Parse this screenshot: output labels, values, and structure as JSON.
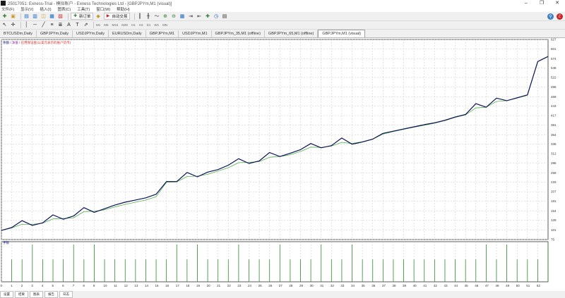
{
  "window": {
    "title": "25017051: Exness-Trial - 模拟账户 - Exness Technologies Ltd - [GBPJPYm,M1 (visual)]",
    "controls": [
      "–",
      "❐",
      "✕"
    ]
  },
  "menu": [
    "文件(F)",
    "显示(V)",
    "插入(I)",
    "图表(C)",
    "工具(T)",
    "窗口(W)",
    "帮助(H)"
  ],
  "toolbar": {
    "new_order_label": "新订单",
    "auto_trading_label": "自动交易",
    "timeframes": [
      "M1",
      "M5",
      "M15",
      "M30",
      "H1",
      "H4",
      "D1",
      "W1",
      "MN"
    ]
  },
  "tabs": [
    {
      "label": "BTCUSDm,Daily",
      "active": false
    },
    {
      "label": "GBPJPYm,Daily",
      "active": false
    },
    {
      "label": "USDJPYm,Daily",
      "active": false
    },
    {
      "label": "EURUSDm,Daily",
      "active": false
    },
    {
      "label": "GBPJPYm,M1",
      "active": false
    },
    {
      "label": "USDJPYm,M1",
      "active": false
    },
    {
      "label": "GBPJPYm_35,M1 (offline)",
      "active": false
    },
    {
      "label": "GBPJPYm_65,M1 (offline)",
      "active": false
    },
    {
      "label": "GBPJPYm,M1 (visual)",
      "active": true
    }
  ],
  "chart_label": {
    "prefix": "余额",
    "middle": " / 净值",
    "suffix": " / 已用保证金(以美元表示的账户货币)"
  },
  "subwindow_label": "手数",
  "bottom_tabs": [
    "设置",
    "结果",
    "图表",
    "报告",
    "日志"
  ],
  "status_text": "",
  "colors": {
    "balance_line": "#0d1257",
    "equity_line": "#55b24f",
    "volume_bars": "#2e8b2e",
    "grid": "#c8c8c8"
  },
  "chart_data": {
    "type": "line",
    "x": [
      0,
      1,
      2,
      3,
      4,
      5,
      6,
      7,
      8,
      9,
      10,
      11,
      12,
      13,
      14,
      15,
      16,
      17,
      18,
      19,
      20,
      21,
      22,
      23,
      24,
      25,
      26,
      27,
      28,
      29,
      30,
      31,
      32,
      33,
      34,
      35,
      36,
      37,
      38,
      39,
      40,
      41,
      42,
      43,
      44,
      45,
      46,
      47,
      48,
      49,
      50,
      51,
      52,
      53
    ],
    "series": [
      {
        "values": [
          100,
          108,
          127,
          114,
          121,
          143,
          131,
          140,
          163,
          150,
          160,
          170,
          178,
          184,
          190,
          200,
          235,
          235,
          260,
          248,
          261,
          268,
          280,
          298,
          285,
          292,
          315,
          304,
          313,
          323,
          340,
          328,
          334,
          355,
          338,
          344,
          352,
          368,
          374,
          380,
          386,
          392,
          397,
          404,
          413,
          420,
          450,
          440,
          465,
          458,
          466,
          474,
          566,
          580
        ]
      },
      {
        "values": [
          100,
          107,
          117,
          117,
          120,
          132,
          133,
          135,
          152,
          153,
          157,
          165,
          172,
          178,
          184,
          193,
          233,
          234,
          249,
          250,
          255,
          264,
          273,
          287,
          288,
          290,
          302,
          304,
          309,
          318,
          330,
          329,
          333,
          343,
          340,
          345,
          352,
          366,
          373,
          379,
          385,
          390,
          396,
          403,
          412,
          419,
          438,
          440,
          456,
          458,
          465,
          473,
          566,
          580
        ]
      }
    ],
    "xlabel": "",
    "ylabel": "",
    "xlim": [
      0,
      53
    ],
    "ylim": [
      75,
      627
    ],
    "y_ticks": [
      75,
      101,
      128,
      154,
      181,
      207,
      233,
      259,
      286,
      312,
      338,
      364,
      391,
      417,
      443,
      469,
      496,
      522,
      548,
      574,
      601,
      627
    ],
    "x_ticks": [
      0,
      1,
      2,
      3,
      4,
      5,
      6,
      7,
      8,
      9,
      10,
      11,
      12,
      13,
      14,
      15,
      16,
      17,
      18,
      19,
      20,
      21,
      22,
      23,
      24,
      25,
      26,
      27,
      28,
      29,
      30,
      31,
      32,
      33,
      34,
      35,
      36,
      37,
      38,
      39,
      40,
      41,
      42,
      43,
      44,
      45,
      46,
      47,
      48,
      49,
      50,
      51,
      52
    ],
    "volume_bars": [
      3,
      3,
      5,
      3,
      3,
      3,
      5,
      3,
      5,
      3,
      3,
      3,
      3,
      3,
      3,
      3,
      5,
      3,
      5,
      3,
      3,
      3,
      5,
      3,
      3,
      3,
      5,
      3,
      3,
      3,
      5,
      3,
      3,
      5,
      3,
      3,
      3,
      3,
      3,
      3,
      3,
      3,
      3,
      3,
      3,
      3,
      5,
      3,
      5,
      3,
      3,
      3,
      5
    ],
    "grid": true
  }
}
